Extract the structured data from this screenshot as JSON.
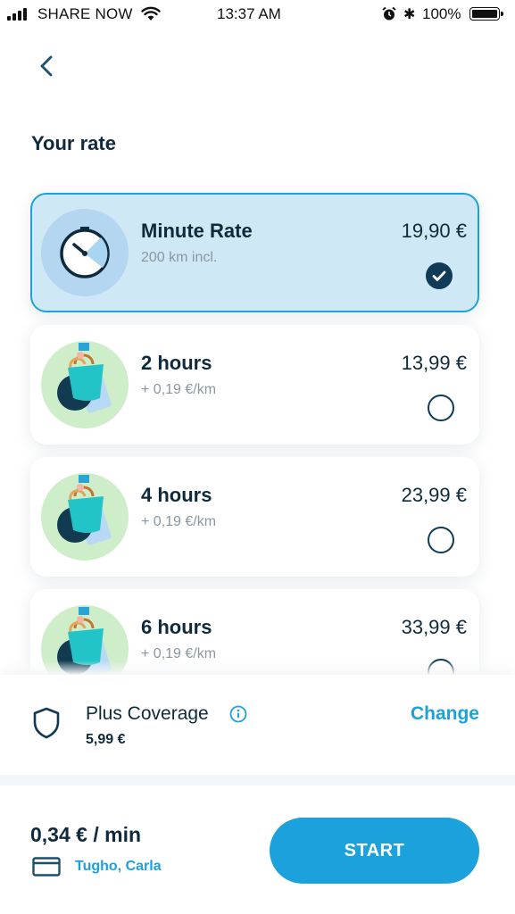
{
  "status_bar": {
    "carrier": "SHARE NOW",
    "time": "13:37 AM",
    "battery_percent": "100%",
    "icons": [
      "signal-icon",
      "wifi-icon",
      "alarm-icon",
      "bluetooth-icon",
      "battery-icon"
    ]
  },
  "header": {
    "back_icon": "chevron-left-icon",
    "title": "Your rate"
  },
  "rates": [
    {
      "name": "Minute Rate",
      "subtitle": "200 km incl.",
      "price": "19,90 €",
      "selected": true,
      "icon": "stopwatch-icon"
    },
    {
      "name": "2 hours",
      "subtitle": "+ 0,19 €/km",
      "price": "13,99 €",
      "selected": false,
      "icon": "shopping-bag-icon"
    },
    {
      "name": "4 hours",
      "subtitle": "+ 0,19 €/km",
      "price": "23,99 €",
      "selected": false,
      "icon": "shopping-bag-icon"
    },
    {
      "name": "6 hours",
      "subtitle": "+ 0,19 €/km",
      "price": "33,99 €",
      "selected": false,
      "icon": "shopping-bag-icon"
    }
  ],
  "coverage": {
    "title": "Plus Coverage",
    "price": "5,99 €",
    "action": "Change"
  },
  "footer": {
    "rate": "0,34 € / min",
    "account": "Tugho, Carla",
    "start_label": "START"
  },
  "colors": {
    "accent": "#1ba1dc",
    "dark": "#0f2a3c",
    "selected_bg": "#cfe8f6",
    "green_circle": "#cdeec8"
  }
}
